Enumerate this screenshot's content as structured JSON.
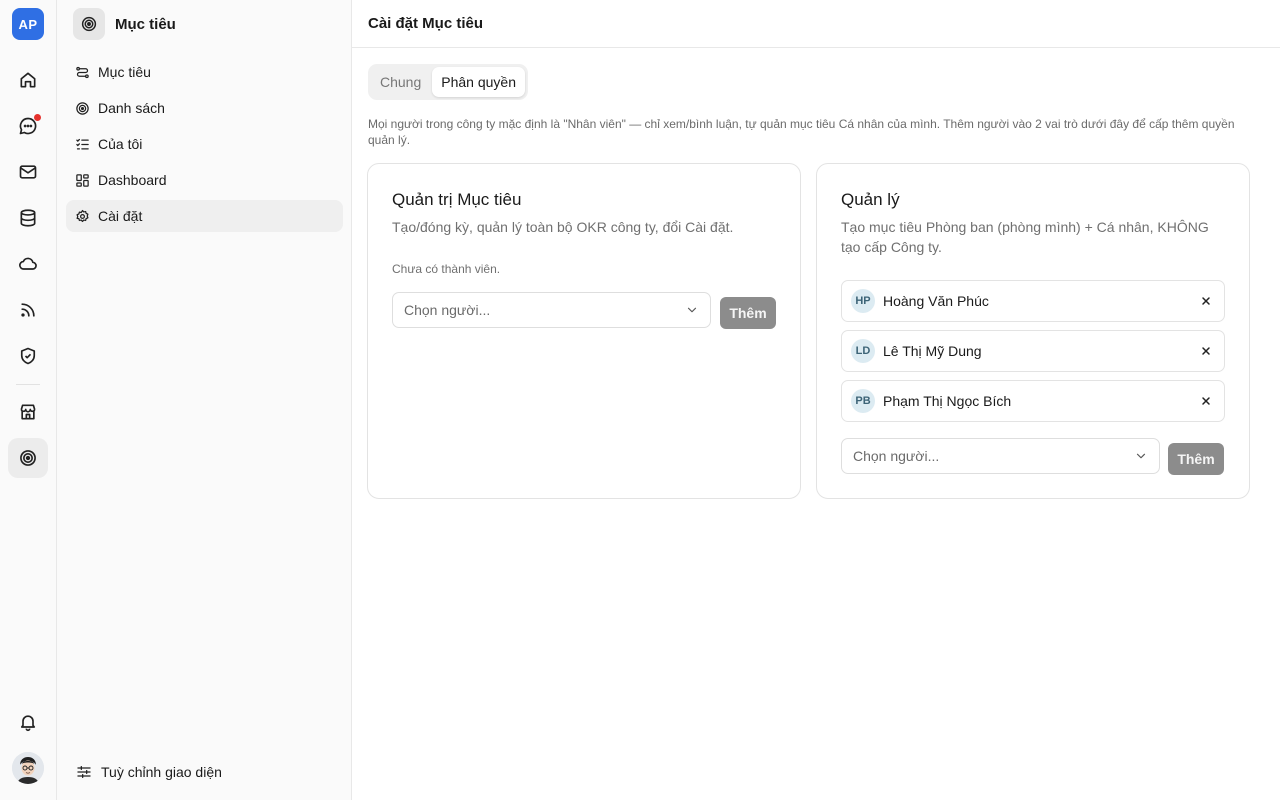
{
  "rail": {
    "logo_text": "AP",
    "items": [
      {
        "icon": "home-icon"
      },
      {
        "icon": "chat-icon",
        "badge": true
      },
      {
        "icon": "mail-icon"
      },
      {
        "icon": "database-icon"
      },
      {
        "icon": "cloud-icon"
      },
      {
        "icon": "rss-icon"
      },
      {
        "icon": "shield-check-icon"
      },
      {
        "icon": "store-icon"
      },
      {
        "icon": "target-icon",
        "active": true
      },
      {
        "icon": "bell-icon"
      }
    ]
  },
  "sidebar": {
    "title": "Mục tiêu",
    "items": [
      {
        "label": "Mục tiêu",
        "icon": "goal-icon"
      },
      {
        "label": "Danh sách",
        "icon": "target-icon"
      },
      {
        "label": "Của tôi",
        "icon": "checklist-icon"
      },
      {
        "label": "Dashboard",
        "icon": "dashboard-icon"
      },
      {
        "label": "Cài đặt",
        "icon": "gear-icon",
        "active": true
      }
    ],
    "footer_label": "Tuỳ chỉnh giao diện"
  },
  "header": {
    "title": "Cài đặt Mục tiêu"
  },
  "tabs": [
    {
      "label": "Chung",
      "active": false
    },
    {
      "label": "Phân quyền",
      "active": true
    }
  ],
  "description": "Mọi người trong công ty mặc định là \"Nhân viên\" — chỉ xem/bình luận, tự quản mục tiêu Cá nhân của mình. Thêm người vào 2 vai trò dưới đây để cấp thêm quyền quản lý.",
  "roles": {
    "admin": {
      "title": "Quản trị Mục tiêu",
      "description": "Tạo/đóng kỳ, quản lý toàn bộ OKR công ty, đổi Cài đặt.",
      "empty_text": "Chưa có thành viên.",
      "select_placeholder": "Chọn người...",
      "add_label": "Thêm"
    },
    "manager": {
      "title": "Quản lý",
      "description": "Tạo mục tiêu Phòng ban (phòng mình) + Cá nhân, KHÔNG tạo cấp Công ty.",
      "members": [
        {
          "initials": "HP",
          "name": "Hoàng Văn Phúc"
        },
        {
          "initials": "LD",
          "name": "Lê Thị Mỹ Dung"
        },
        {
          "initials": "PB",
          "name": "Phạm Thị Ngọc Bích"
        }
      ],
      "select_placeholder": "Chọn người...",
      "add_label": "Thêm"
    }
  }
}
